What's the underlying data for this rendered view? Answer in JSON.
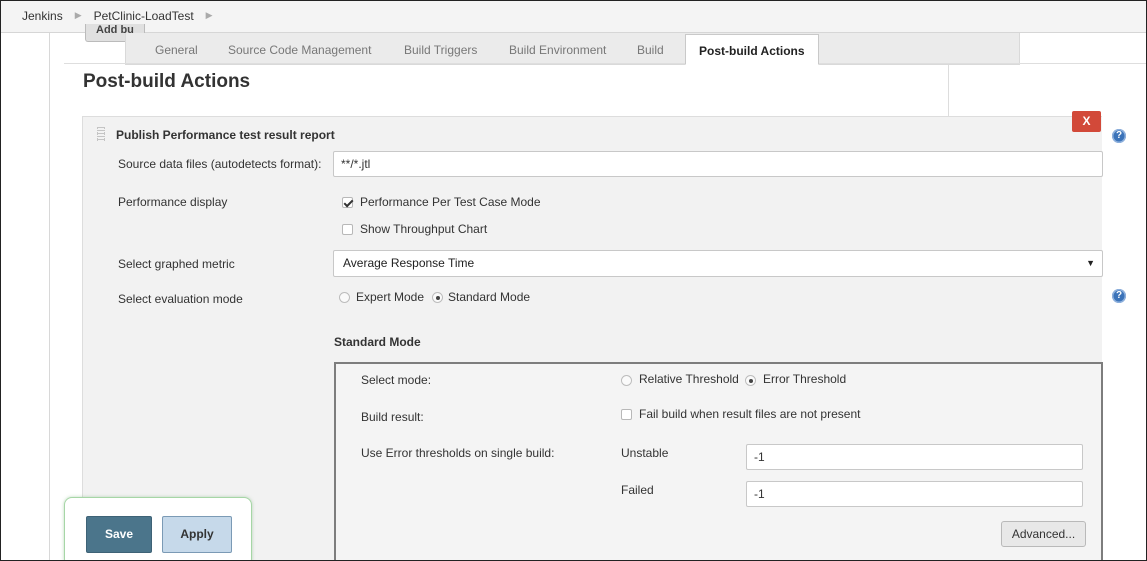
{
  "breadcrumb": {
    "items": [
      "Jenkins",
      "PetClinic-LoadTest"
    ]
  },
  "peek_button": "Add bu",
  "tabs": [
    {
      "label": "General"
    },
    {
      "label": "Source Code Management"
    },
    {
      "label": "Build Triggers"
    },
    {
      "label": "Build Environment"
    },
    {
      "label": "Build"
    },
    {
      "label": "Post-build Actions",
      "active": true
    }
  ],
  "page_title": "Post-build Actions",
  "publisher": {
    "title": "Publish Performance test result report",
    "delete_label": "X",
    "help_glyph": "?",
    "source_files": {
      "label": "Source data files (autodetects format):",
      "value": "**/*.jtl"
    },
    "performance_display": {
      "label": "Performance display",
      "options": [
        {
          "label": "Performance Per Test Case Mode",
          "checked": true
        },
        {
          "label": "Show Throughput Chart",
          "checked": false
        }
      ]
    },
    "graphed_metric": {
      "label": "Select graphed metric",
      "value": "Average Response Time"
    },
    "evaluation_mode": {
      "label": "Select evaluation mode",
      "options": [
        {
          "label": "Expert Mode",
          "selected": false
        },
        {
          "label": "Standard Mode",
          "selected": true
        }
      ]
    },
    "standard_mode": {
      "heading": "Standard Mode",
      "select_mode": {
        "label": "Select mode:",
        "options": [
          {
            "label": "Relative Threshold",
            "selected": false
          },
          {
            "label": "Error Threshold",
            "selected": true
          }
        ]
      },
      "build_result": {
        "label": "Build result:",
        "checkbox_label": "Fail build when result files are not present",
        "checked": false
      },
      "error_thresholds": {
        "label": "Use Error thresholds on single build:",
        "unstable_label": "Unstable",
        "unstable_value": "-1",
        "failed_label": "Failed",
        "failed_value": "-1"
      },
      "advanced_label": "Advanced..."
    }
  },
  "actions": {
    "save_label": "Save",
    "apply_label": "Apply"
  },
  "colors": {
    "save": "#4b758b",
    "apply": "#c6d9ea",
    "delete": "#d24939",
    "help": "#3b73b9"
  },
  "icons": {
    "breadcrumb_separator": "chevron-right-icon",
    "drag": "drag-handle-icon",
    "help": "help-icon",
    "select_arrow": "caret-down-icon"
  }
}
